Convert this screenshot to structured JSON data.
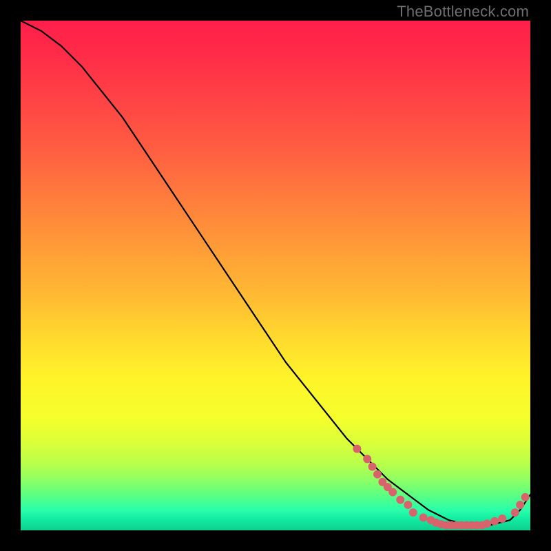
{
  "watermark": "TheBottleneck.com",
  "chart_data": {
    "type": "line",
    "title": "",
    "xlabel": "",
    "ylabel": "",
    "xlim": [
      0,
      100
    ],
    "ylim": [
      0,
      100
    ],
    "curve": {
      "name": "bottleneck-curve",
      "x": [
        0,
        4,
        8,
        12,
        16,
        20,
        24,
        28,
        32,
        36,
        40,
        44,
        48,
        52,
        56,
        60,
        64,
        68,
        72,
        76,
        80,
        84,
        88,
        92,
        96,
        98,
        100
      ],
      "y": [
        100,
        98,
        95,
        91,
        86,
        81,
        75,
        69,
        63,
        57,
        51,
        45,
        39,
        33,
        28,
        23,
        18,
        14,
        10,
        7,
        4,
        2,
        1,
        1,
        2,
        4,
        7
      ]
    },
    "highlight_points": {
      "name": "highlight-dots",
      "color": "#d9636c",
      "points": [
        {
          "x": 66,
          "y": 16
        },
        {
          "x": 68,
          "y": 14
        },
        {
          "x": 69,
          "y": 12.5
        },
        {
          "x": 70,
          "y": 11
        },
        {
          "x": 71,
          "y": 9.5
        },
        {
          "x": 72,
          "y": 8.5
        },
        {
          "x": 73,
          "y": 7.5
        },
        {
          "x": 74.5,
          "y": 6
        },
        {
          "x": 76,
          "y": 5
        },
        {
          "x": 77,
          "y": 3.5
        },
        {
          "x": 79,
          "y": 2.5
        },
        {
          "x": 80.5,
          "y": 2
        },
        {
          "x": 81.5,
          "y": 1.5
        },
        {
          "x": 82.5,
          "y": 1.2
        },
        {
          "x": 83.5,
          "y": 1
        },
        {
          "x": 84.5,
          "y": 1
        },
        {
          "x": 85.5,
          "y": 1
        },
        {
          "x": 86.5,
          "y": 1
        },
        {
          "x": 87.5,
          "y": 1
        },
        {
          "x": 88.5,
          "y": 1
        },
        {
          "x": 89.5,
          "y": 1
        },
        {
          "x": 90.5,
          "y": 1
        },
        {
          "x": 91.5,
          "y": 1.3
        },
        {
          "x": 93,
          "y": 1.8
        },
        {
          "x": 94.5,
          "y": 2.3
        },
        {
          "x": 97,
          "y": 3.5
        },
        {
          "x": 98,
          "y": 5
        },
        {
          "x": 99,
          "y": 6.5
        }
      ]
    }
  }
}
